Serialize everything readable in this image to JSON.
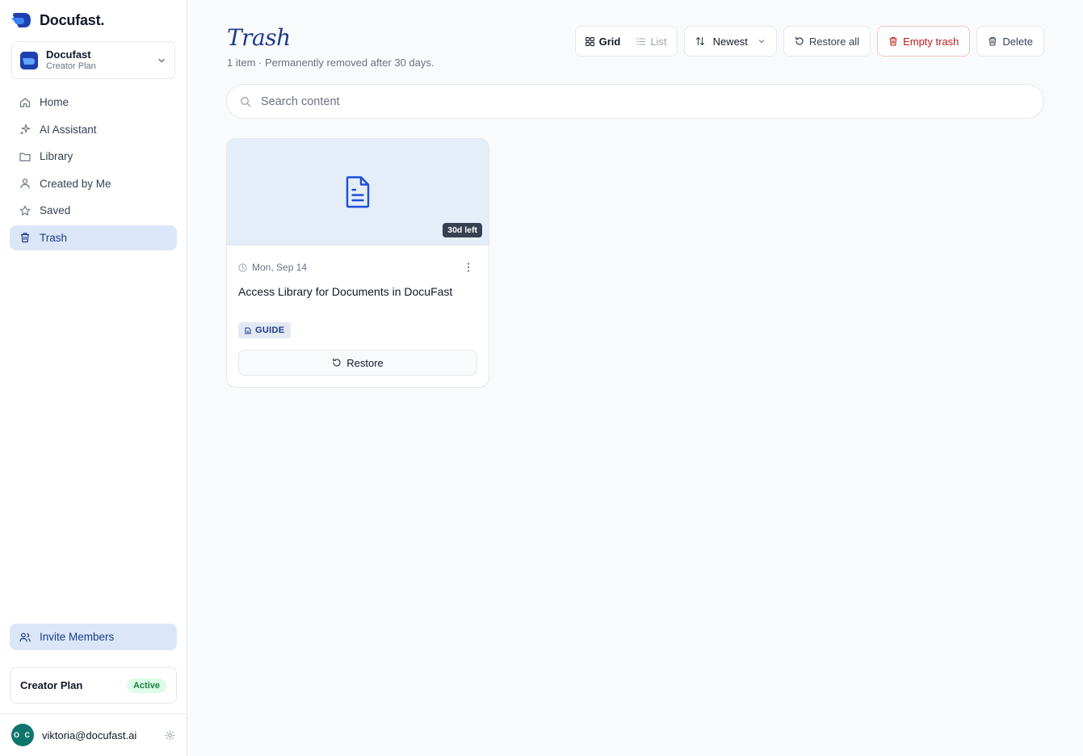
{
  "brand": {
    "name": "Docufast."
  },
  "workspace": {
    "name": "Docufast",
    "plan": "Creator Plan"
  },
  "nav": {
    "items": [
      {
        "label": "Home",
        "icon": "home-icon"
      },
      {
        "label": "AI Assistant",
        "icon": "sparkles-icon"
      },
      {
        "label": "Library",
        "icon": "folder-icon"
      },
      {
        "label": "Created by Me",
        "icon": "user-icon"
      },
      {
        "label": "Saved",
        "icon": "star-icon"
      },
      {
        "label": "Trash",
        "icon": "trash-icon",
        "active": true
      }
    ]
  },
  "invite": {
    "label": "Invite Members"
  },
  "plan_card": {
    "name": "Creator Plan",
    "status": "Active"
  },
  "user": {
    "email": "viktoria@docufast.ai",
    "initials": "O C"
  },
  "page": {
    "title": "Trash",
    "subtitle": "1 item · Permanently removed after 30 days."
  },
  "toolbar": {
    "view_grid": "Grid",
    "view_list": "List",
    "sort": "Newest",
    "restore_all": "Restore all",
    "empty_trash": "Empty trash",
    "delete": "Delete"
  },
  "search": {
    "placeholder": "Search content"
  },
  "items": [
    {
      "days_left": "30d left",
      "date": "Mon, Sep 14",
      "title": "Access Library for Documents in DocuFast",
      "tag": "GUIDE",
      "restore_label": "Restore"
    }
  ],
  "colors": {
    "accent": "#1e3a8a",
    "active_bg": "#dbe7f8",
    "danger": "#b91c1c",
    "success": "#15803d"
  }
}
